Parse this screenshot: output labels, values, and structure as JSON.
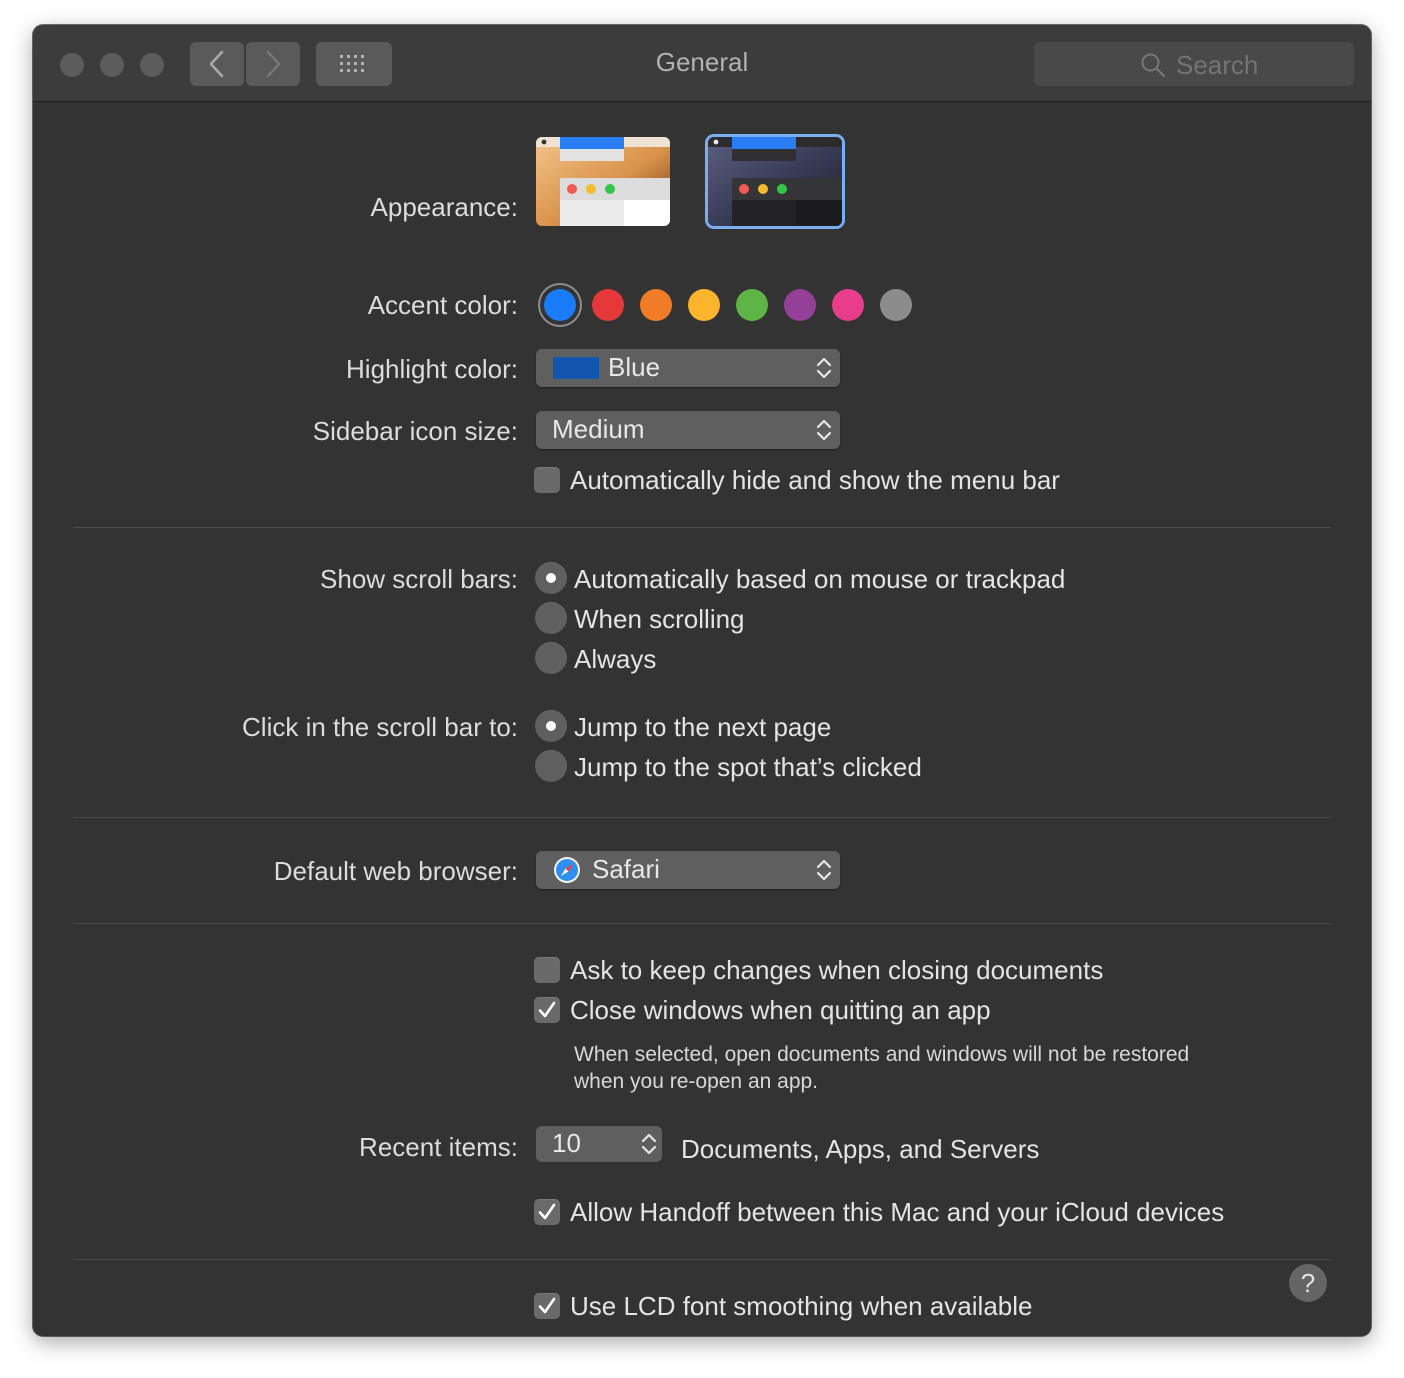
{
  "window": {
    "title": "General"
  },
  "toolbar": {
    "search_placeholder": "Search"
  },
  "appearance": {
    "label": "Appearance:",
    "options": [
      {
        "name": "light",
        "selected": false
      },
      {
        "name": "dark",
        "selected": true
      }
    ]
  },
  "accent": {
    "label": "Accent color:",
    "colors": [
      "#1a7cf8",
      "#e5383b",
      "#f07c27",
      "#fbb52d",
      "#5eb445",
      "#943f98",
      "#e73d8b",
      "#8c8c8c"
    ],
    "selected_index": 0
  },
  "highlight": {
    "label": "Highlight color:",
    "value": "Blue",
    "swatch_color": "#1256b0"
  },
  "sidebar_icon": {
    "label": "Sidebar icon size:",
    "value": "Medium"
  },
  "menu_bar": {
    "label": "Automatically hide and show the menu bar",
    "checked": false
  },
  "scroll_bars": {
    "label": "Show scroll bars:",
    "options": [
      "Automatically based on mouse or trackpad",
      "When scrolling",
      "Always"
    ],
    "selected_index": 0
  },
  "click_scroll": {
    "label": "Click in the scroll bar to:",
    "options": [
      "Jump to the next page",
      "Jump to the spot that’s clicked"
    ],
    "selected_index": 0
  },
  "browser": {
    "label": "Default web browser:",
    "value": "Safari",
    "icon": "safari-icon"
  },
  "ask_keep": {
    "label": "Ask to keep changes when closing documents",
    "checked": false
  },
  "close_windows": {
    "label": "Close windows when quitting an app",
    "checked": true,
    "note_line1": "When selected, open documents and windows will not be restored",
    "note_line2": "when you re-open an app."
  },
  "recent": {
    "label": "Recent items:",
    "value": "10",
    "suffix": "Documents, Apps, and Servers"
  },
  "handoff": {
    "label": "Allow Handoff between this Mac and your iCloud devices",
    "checked": true
  },
  "lcd": {
    "label": "Use LCD font smoothing when available",
    "checked": true
  },
  "help": {
    "glyph": "?"
  }
}
